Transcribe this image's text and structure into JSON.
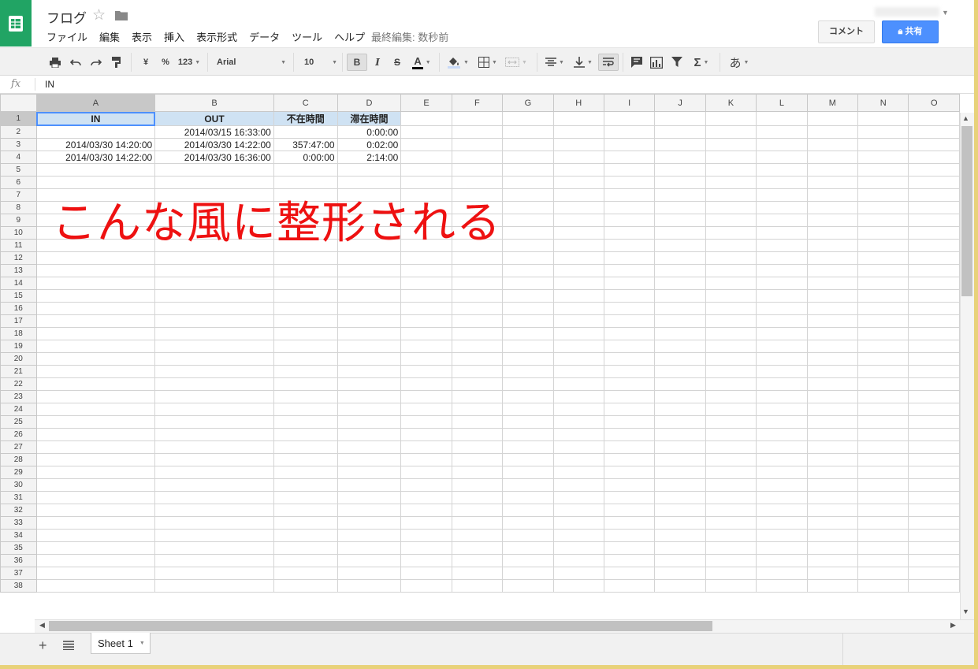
{
  "header": {
    "title": "フログ",
    "menu": [
      "ファイル",
      "編集",
      "表示",
      "挿入",
      "表示形式",
      "データ",
      "ツール",
      "ヘルプ"
    ],
    "last_edit": "最終編集: 数秒前",
    "comment_label": "コメント",
    "share_label": "共有"
  },
  "toolbar": {
    "currency": "¥",
    "percent": "%",
    "number_format": "123",
    "font": "Arial",
    "font_size": "10",
    "bold": "B",
    "italic": "I",
    "strike": "S",
    "text_color": "A",
    "sigma": "Σ",
    "input_tools": "あ",
    "text_color_value": "#000000",
    "fill_color_value": "#c9daf8"
  },
  "formula": {
    "fx": "fx",
    "value": "IN"
  },
  "grid": {
    "columns": [
      "A",
      "B",
      "C",
      "D",
      "E",
      "F",
      "G",
      "H",
      "I",
      "J",
      "K",
      "L",
      "M",
      "N",
      "O"
    ],
    "row_count": 38,
    "header_fill": "#cfe2f3",
    "rows": [
      [
        "IN",
        "OUT",
        "不在時間",
        "滞在時間"
      ],
      [
        "",
        "2014/03/15 16:33:00",
        "",
        "0:00:00"
      ],
      [
        "2014/03/30 14:20:00",
        "2014/03/30 14:22:00",
        "357:47:00",
        "0:02:00"
      ],
      [
        "2014/03/30 14:22:00",
        "2014/03/30 16:36:00",
        "0:00:00",
        "2:14:00"
      ]
    ]
  },
  "annotation": {
    "text": "こんな風に整形される",
    "color": "#ee1111"
  },
  "sheets": {
    "active": "Sheet 1"
  }
}
